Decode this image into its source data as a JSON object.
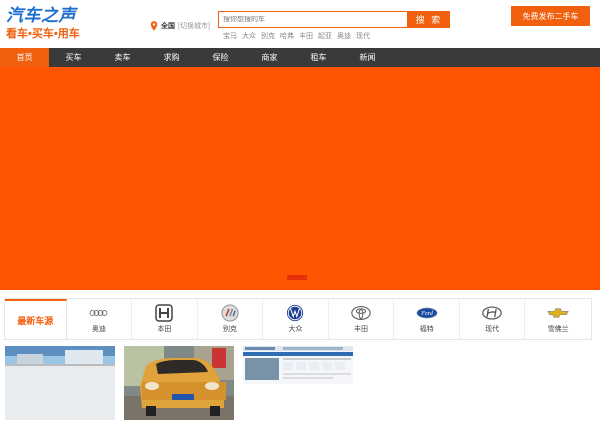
{
  "header": {
    "logo_main": "汽车之声",
    "logo_sub": "看车•买车•用车",
    "city": "全国",
    "switch_city": "[切换城市]",
    "search_placeholder": "搜你想搜的车",
    "search_button": "搜 索",
    "hot_words": [
      "宝马",
      "大众",
      "别克",
      "哈弗",
      "丰田",
      "起亚",
      "奥迪",
      "现代"
    ],
    "publish_button": "免费发布二手车"
  },
  "nav": {
    "items": [
      "首页",
      "买车",
      "卖车",
      "求购",
      "保险",
      "商家",
      "租车",
      "新闻"
    ],
    "active_index": 0
  },
  "banner": {
    "color": "#ff5400",
    "slide_count": 1,
    "active_slide": 0
  },
  "brands": {
    "tab_label": "最新车源",
    "items": [
      {
        "name": "奥迪",
        "icon": "audi-icon"
      },
      {
        "name": "本田",
        "icon": "honda-icon"
      },
      {
        "name": "别克",
        "icon": "buick-icon"
      },
      {
        "name": "大众",
        "icon": "volkswagen-icon"
      },
      {
        "name": "丰田",
        "icon": "toyota-icon"
      },
      {
        "name": "福特",
        "icon": "ford-icon"
      },
      {
        "name": "现代",
        "icon": "hyundai-icon"
      },
      {
        "name": "雪佛兰",
        "icon": "chevrolet-icon"
      }
    ]
  },
  "colors": {
    "accent": "#f0600f",
    "nav_bg": "#3a3a3a",
    "logo_blue": "#1f6fd0"
  }
}
